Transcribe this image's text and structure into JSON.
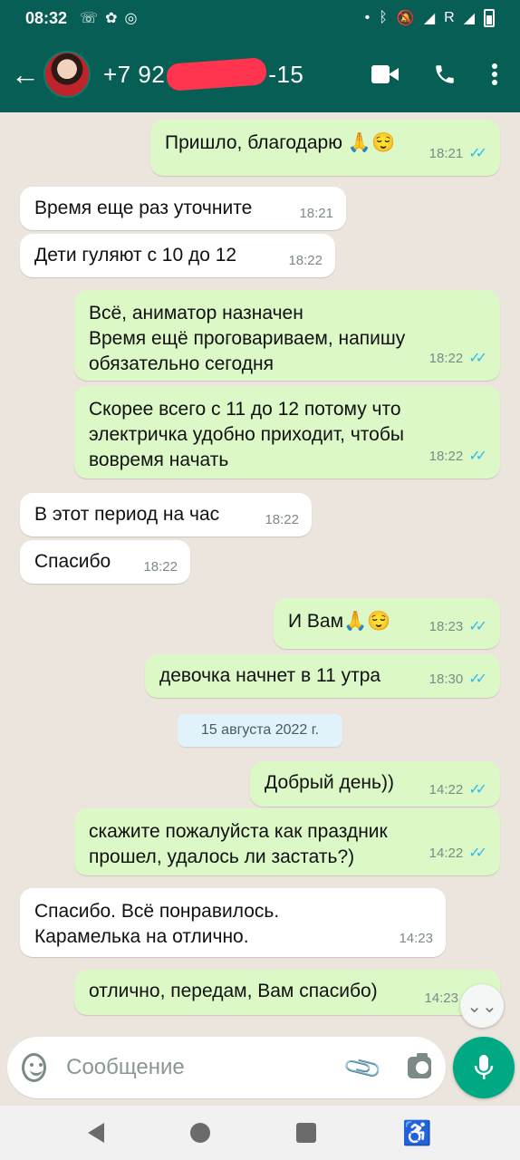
{
  "status_bar": {
    "time": "08:32",
    "left_icons": [
      "missed-call-icon",
      "app-icon",
      "messenger-icon"
    ],
    "right_icons": [
      "dot-icon",
      "bluetooth-icon",
      "mute-icon",
      "wifi-icon",
      "roaming-r",
      "signal-icon",
      "battery-icon"
    ],
    "roaming_label": "R"
  },
  "header": {
    "contact_prefix": "+7 92",
    "contact_suffix": "-15"
  },
  "messages": [
    {
      "dir": "out",
      "text": "Пришло, благодарю 🙏😌",
      "time": "18:21",
      "ticks": "✓✓"
    },
    {
      "dir": "in",
      "text": "Время еще раз уточните",
      "time": "18:21"
    },
    {
      "dir": "in",
      "text": "Дети гуляют с 10 до 12",
      "time": "18:22"
    },
    {
      "dir": "out",
      "text": "Всё, аниматор назначен\nВремя ещё проговариваем, напишу обязательно сегодня",
      "time": "18:22",
      "ticks": "✓✓"
    },
    {
      "dir": "out",
      "text": "Скорее всего с 11 до 12 потому что электричка удобно приходит, чтобы вовремя начать",
      "time": "18:22",
      "ticks": "✓✓"
    },
    {
      "dir": "in",
      "text": "В этот период на час",
      "time": "18:22"
    },
    {
      "dir": "in",
      "text": "Спасибо",
      "time": "18:22"
    },
    {
      "dir": "out",
      "text": "И Вам🙏😌",
      "time": "18:23",
      "ticks": "✓✓"
    },
    {
      "dir": "out",
      "text": "девочка начнет в 11 утра",
      "time": "18:30",
      "ticks": "✓✓"
    },
    {
      "dir": "out",
      "text": "Добрый день))",
      "time": "14:22",
      "ticks": "✓✓"
    },
    {
      "dir": "out",
      "text": "скажите пожалуйста как праздник прошел, удалось ли застать?)",
      "time": "14:22",
      "ticks": "✓✓"
    },
    {
      "dir": "in",
      "text": "Спасибо. Всё понравилось.\nКарамелька на отлично.",
      "time": "14:23"
    },
    {
      "dir": "out",
      "text": "отлично, передам, Вам спасибо)",
      "time": "14:23"
    }
  ],
  "date_separator": "15 августа 2022 г.",
  "composer": {
    "placeholder": "Сообщение"
  },
  "colors": {
    "header": "#075e54",
    "outgoing_bubble": "#dcf8c6",
    "incoming_bubble": "#ffffff",
    "chat_background": "#ece5dd",
    "read_ticks": "#34b7f1",
    "mic_button": "#00a884"
  }
}
